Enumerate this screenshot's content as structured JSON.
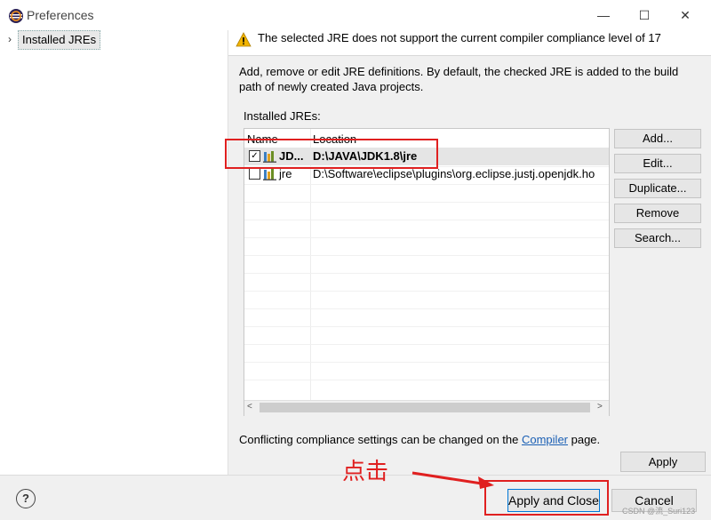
{
  "window": {
    "title": "Preferences",
    "minimize_glyph": "—",
    "maximize_glyph": "☐",
    "close_glyph": "✕"
  },
  "nav": {
    "chevron": "›",
    "items": [
      {
        "label": "Installed JREs",
        "selected": true
      }
    ]
  },
  "warning": {
    "text": "The selected JRE does not support the current compiler compliance level of 17"
  },
  "description": {
    "line1": "Add, remove or edit JRE definitions. By default, the checked JRE is added to the build",
    "line2": "path of newly created Java projects."
  },
  "installed_jres": {
    "label": "Installed JREs:",
    "columns": [
      "Name",
      "Location"
    ],
    "rows": [
      {
        "name": "JD...",
        "location": "D:\\JAVA\\JDK1.8\\jre",
        "checked": true,
        "bold": true
      },
      {
        "name": "jre",
        "location": "D:\\Software\\eclipse\\plugins\\org.eclipse.justj.openjdk.ho",
        "checked": false,
        "bold": false
      }
    ],
    "check_glyph": "✓",
    "scroll_left": "<",
    "scroll_right": ">"
  },
  "side_buttons": {
    "add": "Add...",
    "edit": "Edit...",
    "duplicate": "Duplicate...",
    "remove": "Remove",
    "search": "Search..."
  },
  "conflict": {
    "before": "Conflicting compliance settings can be changed on the ",
    "link": "Compiler",
    "after": " page."
  },
  "buttons": {
    "apply": "Apply",
    "apply_and_close": "Apply and Close",
    "cancel": "Cancel",
    "help": "?"
  },
  "annotation": {
    "text": "点击",
    "color": "#e02020"
  },
  "watermark": "CSDN @流_Suri123",
  "colors": {
    "link": "#1a5fb4",
    "focus": "#0078d7",
    "warning": "#f2b400"
  }
}
